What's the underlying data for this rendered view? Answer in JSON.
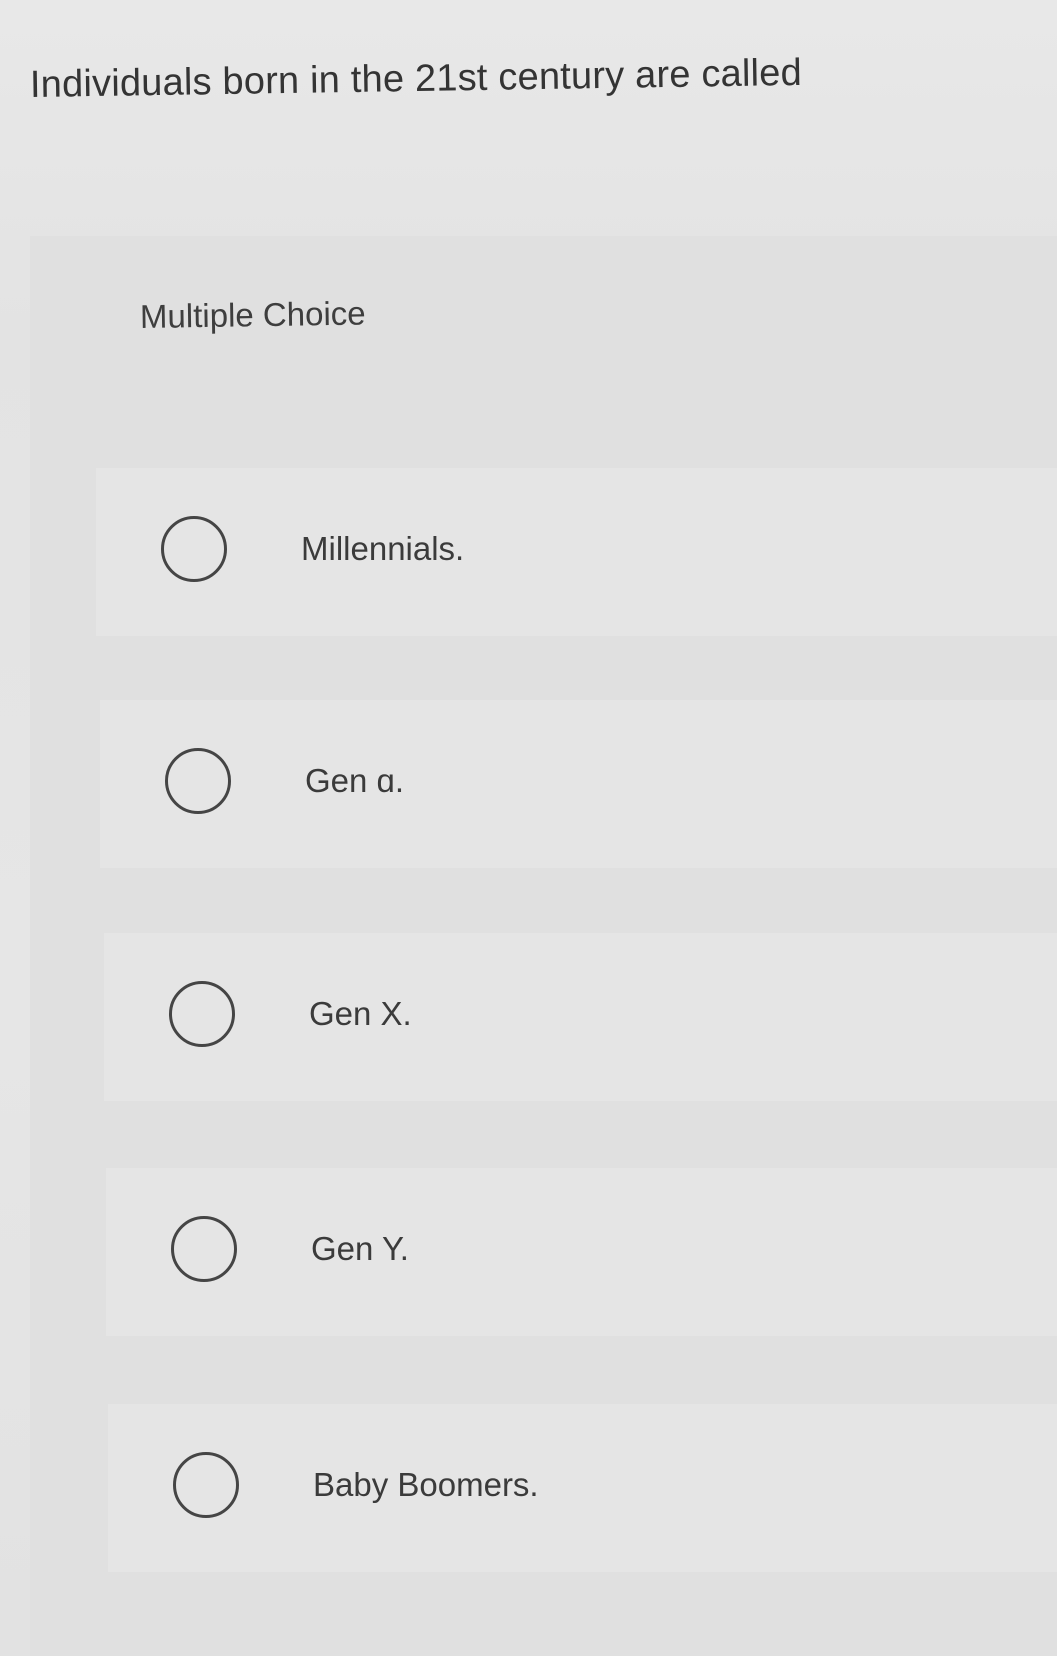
{
  "question": {
    "text": "Individuals born in the 21st century are called"
  },
  "answer_panel": {
    "label": "Multiple Choice",
    "options": [
      {
        "label": "Millennials.",
        "selected": false
      },
      {
        "label": "Gen ɑ.",
        "selected": false
      },
      {
        "label": "Gen X.",
        "selected": false
      },
      {
        "label": "Gen Y.",
        "selected": false
      },
      {
        "label": "Baby Boomers.",
        "selected": false
      }
    ]
  },
  "colors": {
    "background": "#e9e9e9",
    "panel": "#e0e0e0",
    "option_row": "#e5e5e5",
    "text": "#343434",
    "radio_border": "#454545"
  }
}
